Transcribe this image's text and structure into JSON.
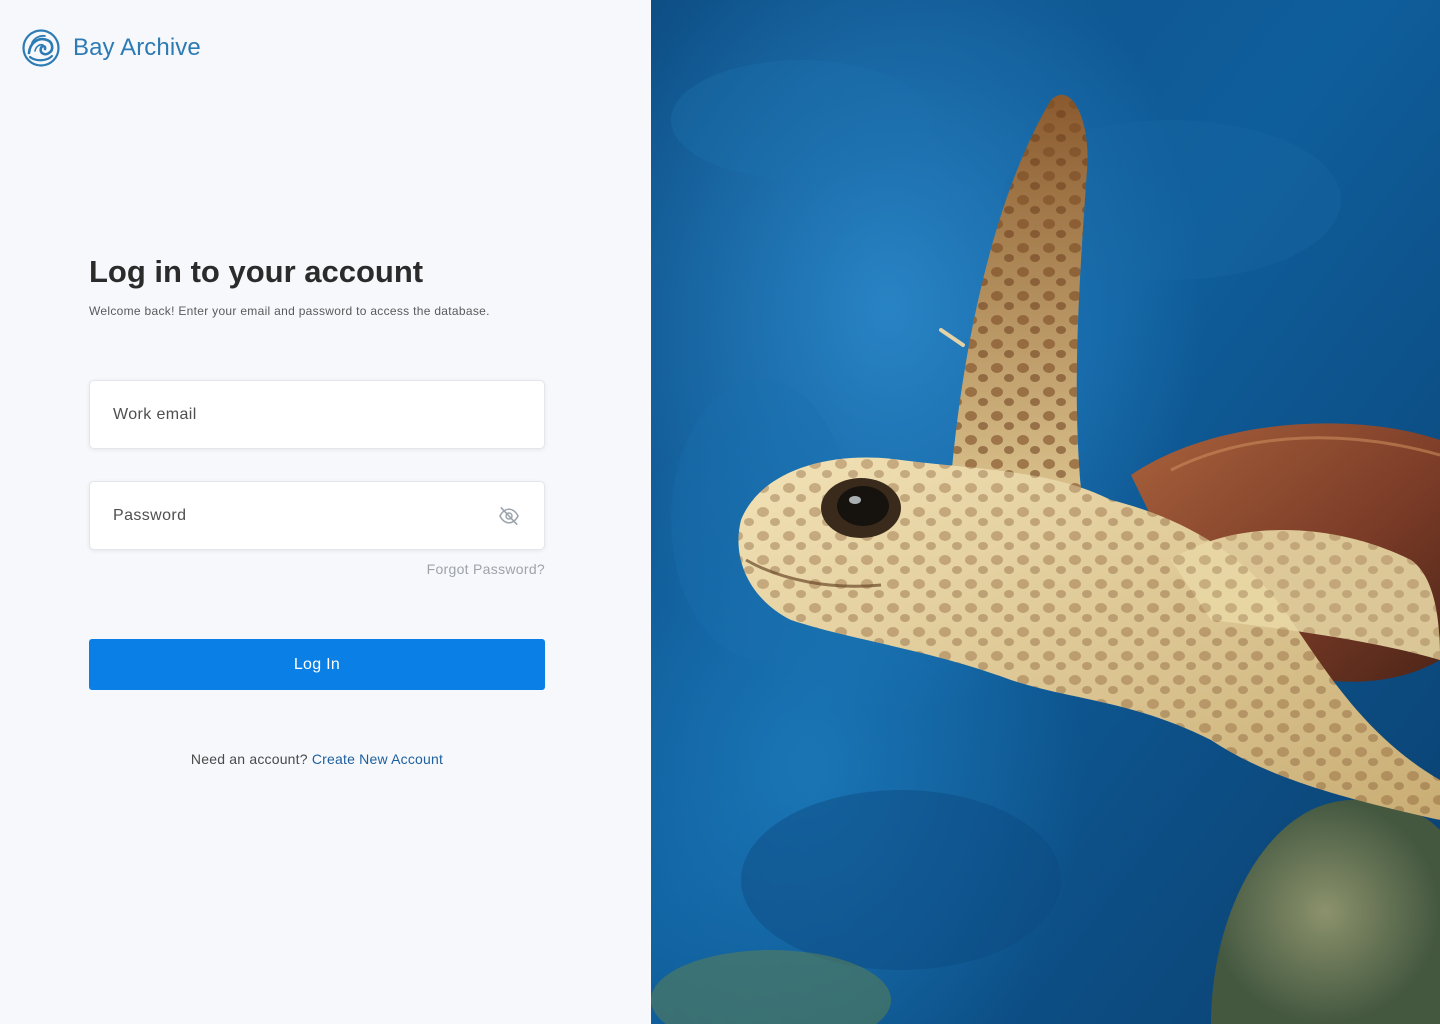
{
  "brand": {
    "name": "Bay Archive"
  },
  "login": {
    "title": "Log in to your account",
    "subtitle": "Welcome back! Enter your email and password to access the database.",
    "email_placeholder": "Work email",
    "password_placeholder": "Password",
    "forgot_label": "Forgot Password?",
    "submit_label": "Log In",
    "signup_prompt": "Need an account?",
    "signup_link": "Create New Account"
  },
  "colors": {
    "brand": "#2d7bb4",
    "primary_button": "#0a80e6",
    "link": "#1e5f9e",
    "background": "#f6f8fc"
  },
  "icons": {
    "logo": "spiral-wave-logo-icon",
    "password_toggle": "eye-off-icon"
  }
}
